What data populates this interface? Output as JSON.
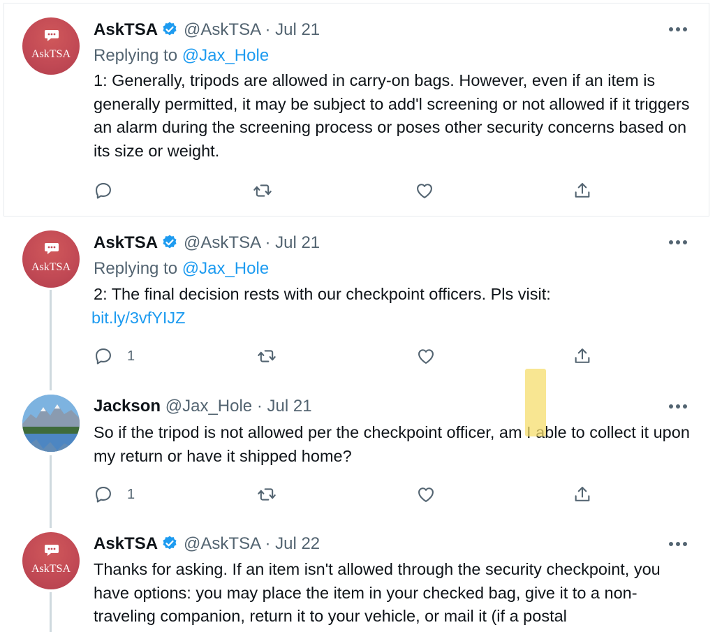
{
  "tweets": [
    {
      "name": "AskTSA",
      "handle": "@AskTSA",
      "separator": "·",
      "date": "Jul 21",
      "avatar_text": "AskTSA",
      "verified": true,
      "replying_label": "Replying to",
      "replying_to": "@Jax_Hole",
      "text": "1: Generally, tripods are allowed in carry-on bags. However, even if an item is generally permitted, it may be subject to add'l screening or not allowed if it triggers an alarm during the screening process or poses other security concerns based on its size or weight.",
      "reply_count": ""
    },
    {
      "name": "AskTSA",
      "handle": "@AskTSA",
      "separator": "·",
      "date": "Jul 21",
      "avatar_text": "AskTSA",
      "verified": true,
      "replying_label": "Replying to",
      "replying_to": "@Jax_Hole",
      "text": "2: The final decision rests with our checkpoint officers. Pls visit:",
      "link": "bit.ly/3vfYIJZ",
      "reply_count": "1"
    },
    {
      "name": "Jackson",
      "handle": "@Jax_Hole",
      "separator": "·",
      "date": "Jul 21",
      "verified": false,
      "text": "So if the tripod is not allowed per the checkpoint officer, am I able to collect it upon my return or have it shipped home?",
      "reply_count": "1"
    },
    {
      "name": "AskTSA",
      "handle": "@AskTSA",
      "separator": "·",
      "date": "Jul 22",
      "avatar_text": "AskTSA",
      "verified": true,
      "text": "Thanks for asking. If an item isn't allowed through the security checkpoint, you have options: you may place the item in your checked bag, give it to a non-traveling companion, return it to your vehicle, or mail it (if a postal"
    }
  ],
  "colors": {
    "accent": "#1d9bf0",
    "secondary_text": "#536471",
    "avatar_tsa": "#c24a55",
    "highlight": "#f6dd6e"
  },
  "icons": [
    "reply-icon",
    "retweet-icon",
    "like-icon",
    "share-icon",
    "verified-badge-icon",
    "more-icon"
  ]
}
